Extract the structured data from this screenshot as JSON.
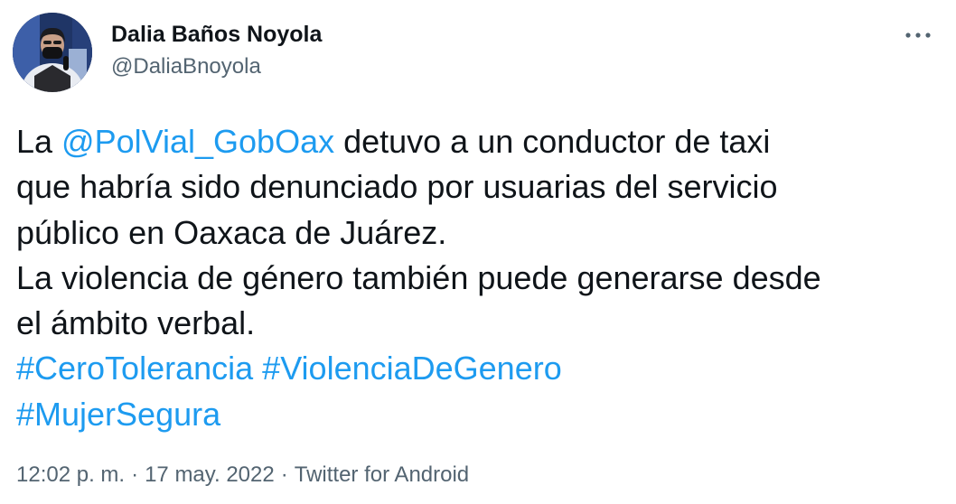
{
  "author": {
    "display_name": "Dalia Baños Noyola",
    "handle": "@DaliaBnoyola"
  },
  "header": {
    "more_icon": "ellipsis-horizontal-icon"
  },
  "tweet": {
    "lines": [
      [
        {
          "text": "La ",
          "type": "text"
        },
        {
          "text": "@PolVial_GobOax",
          "type": "mention"
        },
        {
          "text": " detuvo a un conductor de taxi",
          "type": "text"
        }
      ],
      [
        {
          "text": "que habría sido denunciado por usuarias del servicio",
          "type": "text"
        }
      ],
      [
        {
          "text": "público en Oaxaca de Juárez.",
          "type": "text"
        }
      ],
      [
        {
          "text": "La violencia de género también puede generarse desde",
          "type": "text"
        }
      ],
      [
        {
          "text": "el ámbito verbal.",
          "type": "text"
        }
      ],
      [
        {
          "text": "#CeroTolerancia",
          "type": "hashtag"
        },
        {
          "text": " ",
          "type": "text"
        },
        {
          "text": "#ViolenciaDeGenero",
          "type": "hashtag"
        }
      ],
      [
        {
          "text": "#MujerSegura",
          "type": "hashtag"
        }
      ]
    ]
  },
  "meta": {
    "time": "12:02 p. m.",
    "separator": "·",
    "date": "17 may. 2022",
    "source": "Twitter for Android"
  },
  "colors": {
    "link": "#1d9bf0",
    "text": "#0f1419",
    "secondary": "#536471"
  }
}
